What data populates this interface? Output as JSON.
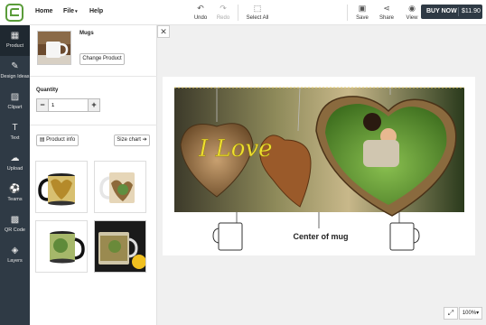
{
  "topbar": {
    "menu": {
      "home": "Home",
      "file": "File",
      "help": "Help"
    },
    "tools": {
      "undo": "Undo",
      "redo": "Redo",
      "select_all": "Select All",
      "save": "Save",
      "share": "Share",
      "view": "View"
    },
    "buy_now": {
      "label": "BUY NOW",
      "price": "$11.90"
    }
  },
  "sidebar": {
    "items": [
      {
        "label": "Product",
        "icon": "grid-icon"
      },
      {
        "label": "Design Ideas",
        "icon": "design-ideas-icon"
      },
      {
        "label": "Clipart",
        "icon": "image-icon"
      },
      {
        "label": "Text",
        "icon": "text-icon"
      },
      {
        "label": "Upload",
        "icon": "upload-icon"
      },
      {
        "label": "Teams",
        "icon": "teams-icon"
      },
      {
        "label": "QR Code",
        "icon": "qr-code-icon"
      },
      {
        "label": "Layers",
        "icon": "layers-icon"
      }
    ]
  },
  "product": {
    "name": "Mugs",
    "change_button": "Change Product",
    "quantity_label": "Quantity",
    "quantity_value": "1",
    "product_info": "Product info",
    "size_chart": "Size chart"
  },
  "canvas": {
    "script_text": "I Love",
    "center_label": "Center of mug",
    "zoom": "100%"
  },
  "colors": {
    "sidebar_bg": "#2f3a45",
    "accent_green": "#5a9c3a",
    "script_yellow": "#f0e030"
  }
}
